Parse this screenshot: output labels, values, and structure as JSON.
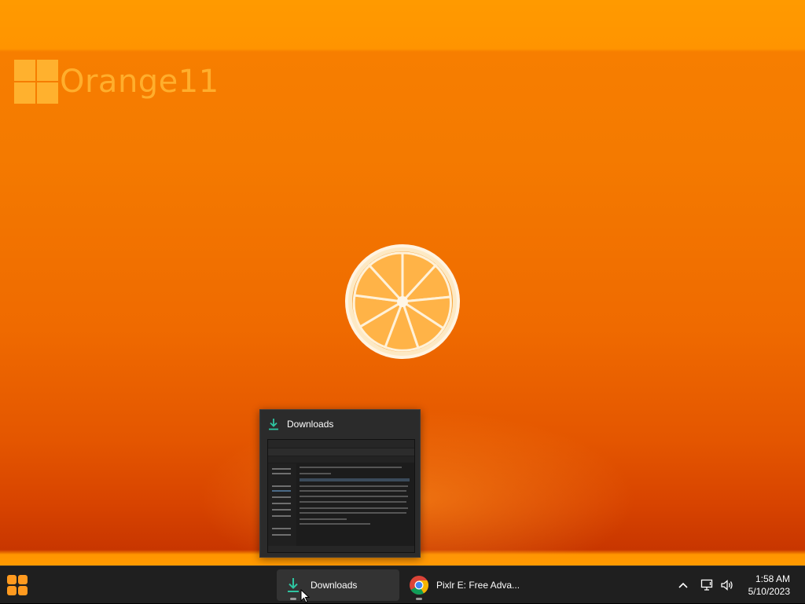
{
  "desktop": {
    "brand_text": "Orange11"
  },
  "preview": {
    "title": "Downloads",
    "icon": "download-icon"
  },
  "taskbar": {
    "start_icon": "start-menu-icon",
    "items": [
      {
        "label": "Downloads",
        "icon": "download-icon",
        "active": true
      },
      {
        "label": "Pixlr E: Free Adva...",
        "icon": "chrome-icon",
        "active": false
      }
    ],
    "tray": {
      "chevron_icon": "chevron-up-icon",
      "network_icon": "network-icon",
      "volume_icon": "volume-icon"
    },
    "clock": {
      "time": "1:58 AM",
      "date": "5/10/2023"
    }
  },
  "colors": {
    "accent_orange": "#ff9a1f",
    "download_green": "#2ec4a0",
    "taskbar_bg": "#1f1f1f"
  }
}
